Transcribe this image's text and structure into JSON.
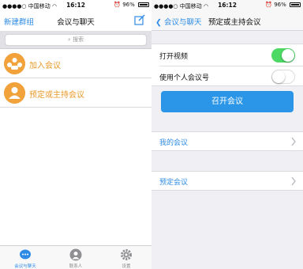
{
  "left": {
    "status": {
      "carrier": "中国移动",
      "time": "16:12",
      "battery": "96%"
    },
    "nav": {
      "left_label": "新建群组",
      "title": "会议与聊天"
    },
    "search": {
      "placeholder": "搜索"
    },
    "rows": [
      {
        "label": "加入会议"
      },
      {
        "label": "预定或主持会议"
      }
    ],
    "tabs": [
      {
        "label": "会议与聊天"
      },
      {
        "label": "联系人"
      },
      {
        "label": "设置"
      }
    ]
  },
  "right": {
    "status": {
      "carrier": "中国移动",
      "time": "16:12",
      "battery": "96%"
    },
    "nav": {
      "back_label": "会议与聊天",
      "title": "预定或主持会议"
    },
    "video_label": "打开视频",
    "video_on": true,
    "personal_id_label": "使用个人会议号",
    "personal_id_on": false,
    "start_button": "召开会议",
    "my_meetings": "我的会议",
    "schedule": "预定会议"
  },
  "colors": {
    "accent": "#2e8be6",
    "orange": "#f2a23a",
    "green": "#4cd964",
    "button": "#2b96e8"
  }
}
